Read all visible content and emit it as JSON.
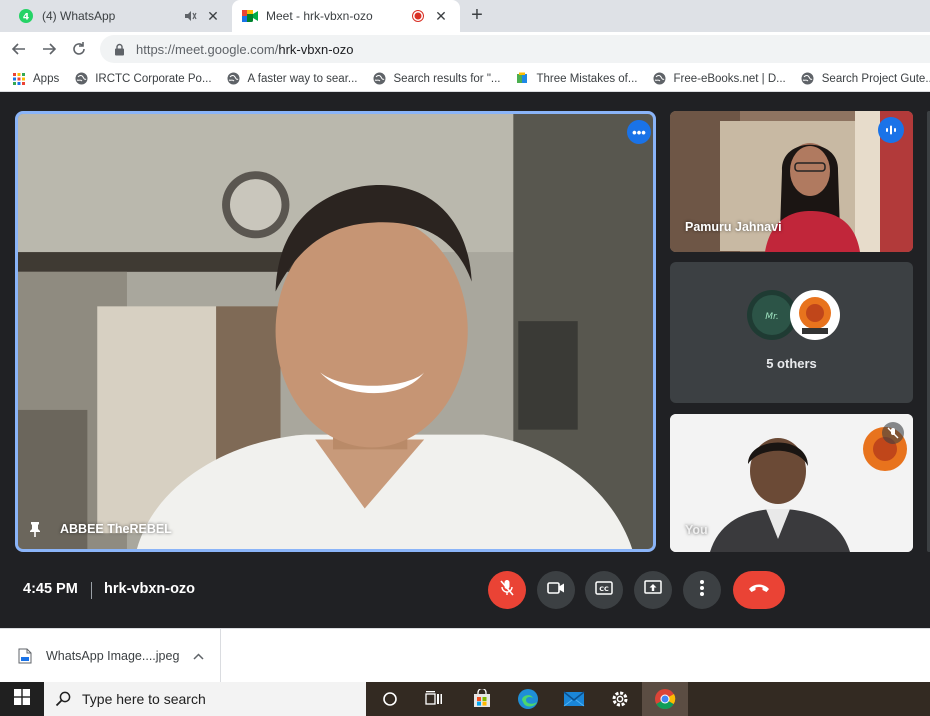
{
  "tabs": [
    {
      "title": "(4) WhatsApp",
      "active": false
    },
    {
      "title": "Meet - hrk-vbxn-ozo",
      "active": true
    }
  ],
  "address": {
    "host": "https://meet.google.com/",
    "path": "hrk-vbxn-ozo"
  },
  "bookmarks": [
    {
      "label": "Apps",
      "icon": "apps-grid-icon"
    },
    {
      "label": "IRCTC Corporate Po...",
      "icon": "globe-icon"
    },
    {
      "label": "A faster way to sear...",
      "icon": "globe-icon"
    },
    {
      "label": "Search results for \"...",
      "icon": "globe-icon"
    },
    {
      "label": "Three Mistakes of...",
      "icon": "book-icon"
    },
    {
      "label": "Free-eBooks.net | D...",
      "icon": "globe-icon"
    },
    {
      "label": "Search Project Gute...",
      "icon": "globe-icon"
    }
  ],
  "meet": {
    "main_participant": "ABBEE TheREBEL",
    "tiles": [
      {
        "name": "Pamuru Jahnavi"
      },
      {
        "name": "5 others"
      },
      {
        "name": "You"
      }
    ],
    "time": "4:45 PM",
    "meeting_code": "hrk-vbxn-ozo"
  },
  "downloads": {
    "file": "WhatsApp Image....jpeg"
  },
  "taskbar": {
    "search_placeholder": "Type here to search"
  },
  "colors": {
    "accent": "#1a73e8",
    "danger": "#ea4335",
    "meet_bg": "#202124"
  }
}
